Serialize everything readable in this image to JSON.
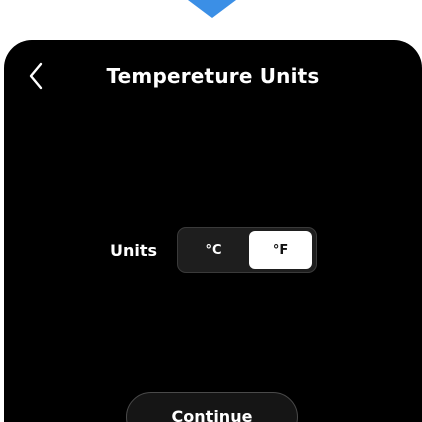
{
  "header": {
    "title": "Tempereture Units",
    "back_icon": "chevron-left-icon"
  },
  "units": {
    "label": "Units",
    "options": [
      "°C",
      "°F"
    ],
    "selected": "°F"
  },
  "footer": {
    "continue_label": "Continue"
  },
  "colors": {
    "pointer": "#3b8fe6",
    "background": "#000000",
    "selected_segment": "#ffffff"
  }
}
